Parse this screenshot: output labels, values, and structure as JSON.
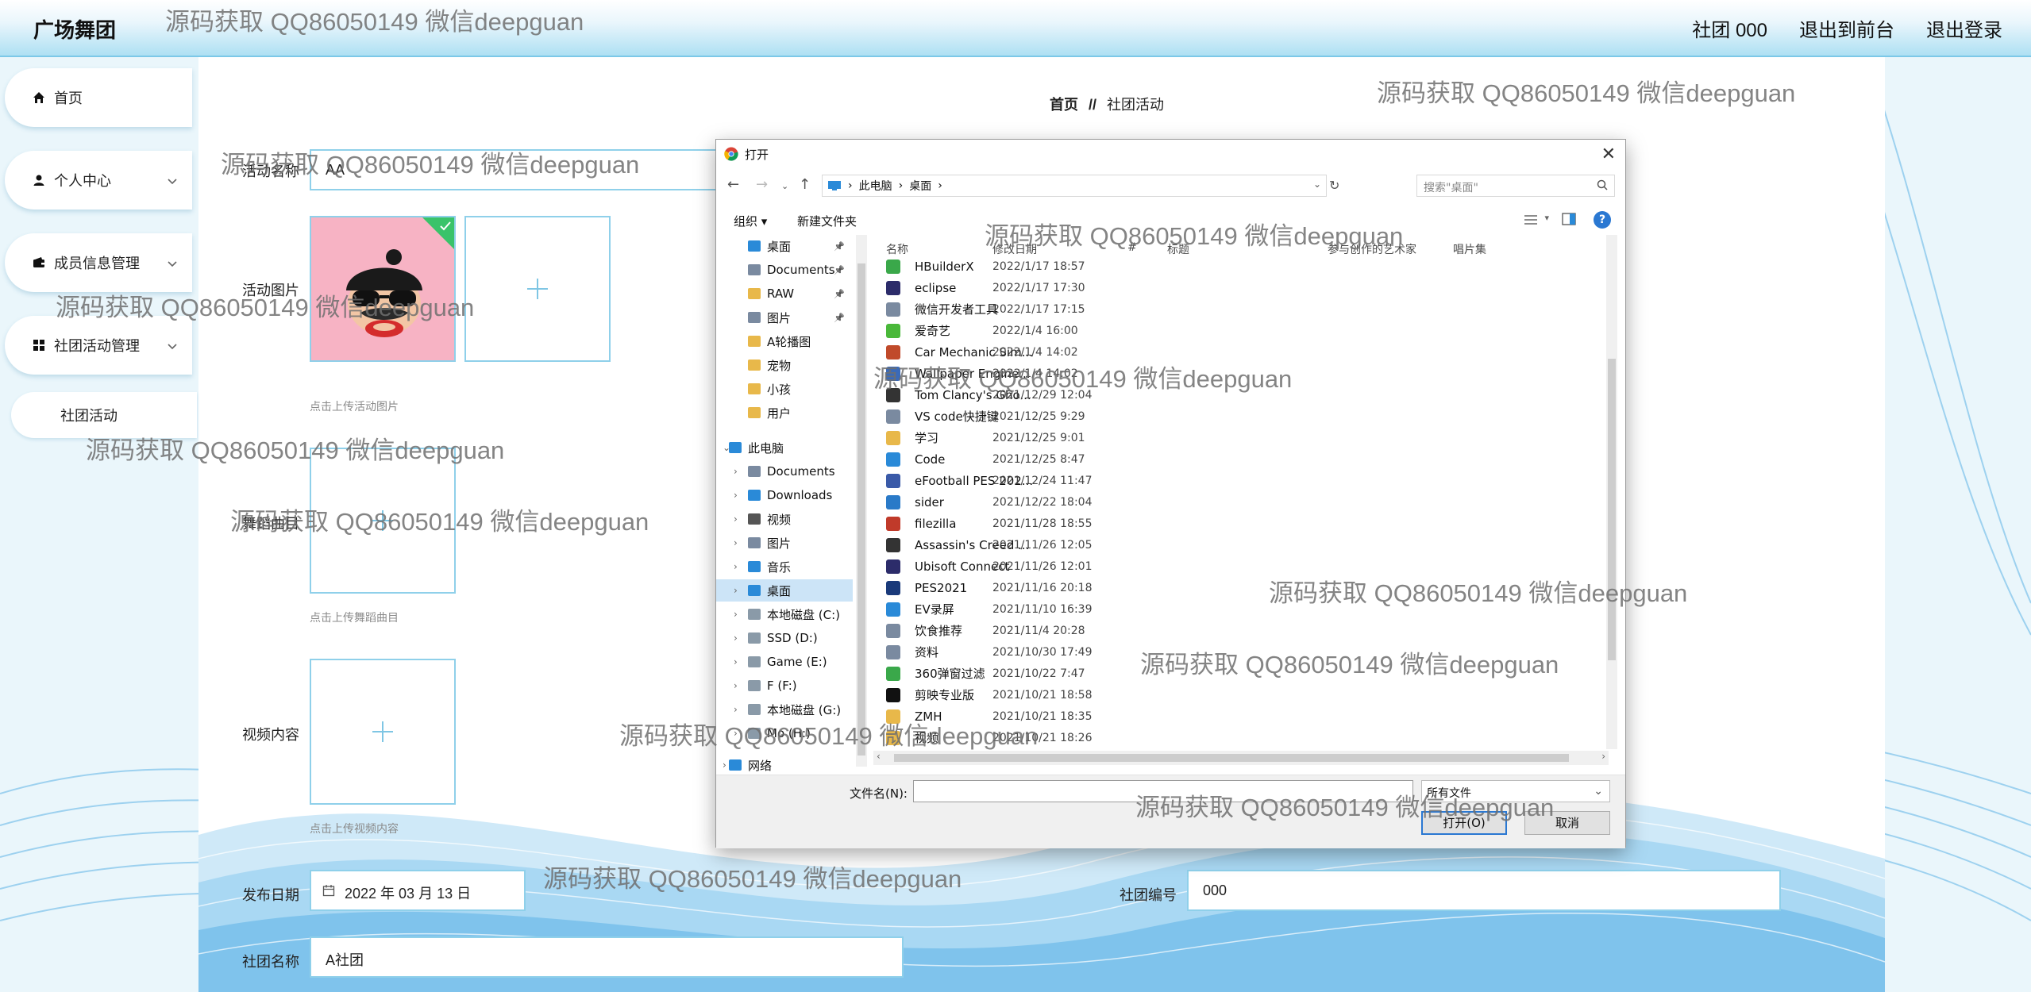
{
  "brand": "广场舞团",
  "topnav": [
    "社团 000",
    "退出到前台",
    "退出登录"
  ],
  "sidebar": {
    "items": [
      {
        "label": "首页"
      },
      {
        "label": "个人中心"
      },
      {
        "label": "成员信息管理"
      },
      {
        "label": "社团活动管理"
      }
    ],
    "sub_item": "社团活动"
  },
  "breadcrumb": {
    "home": "首页",
    "sep": "//",
    "current": "社团活动"
  },
  "form": {
    "activity_name_label": "活动名称",
    "activity_name_value": "AA",
    "activity_image_label": "活动图片",
    "activity_image_hint": "点击上传活动图片",
    "music_label": "舞蹈曲目",
    "music_hint": "点击上传舞蹈曲目",
    "video_label": "视频内容",
    "video_hint": "点击上传视频内容",
    "date_label": "发布日期",
    "date_value": "2022 年 03 月 13 日",
    "club_no_label": "社团编号",
    "club_no_value": "000",
    "club_name_label": "社团名称",
    "club_name_value": "A社团"
  },
  "dialog": {
    "title": "打开",
    "path": [
      "此电脑",
      "桌面"
    ],
    "search_placeholder": "搜索\"桌面\"",
    "organize": "组织 ▾",
    "new_folder": "新建文件夹",
    "tree": [
      {
        "label": "桌面",
        "pinned": true,
        "color": "#2a8ad8"
      },
      {
        "label": "Documents",
        "pinned": true,
        "color": "#7a8aa0"
      },
      {
        "label": "RAW",
        "pinned": true,
        "color": "#e8b84a"
      },
      {
        "label": "图片",
        "pinned": true,
        "color": "#7a8aa0"
      },
      {
        "label": "A轮播图",
        "pinned": false,
        "color": "#e8b84a"
      },
      {
        "label": "宠物",
        "pinned": false,
        "color": "#e8b84a"
      },
      {
        "label": "小孩",
        "pinned": false,
        "color": "#e8b84a"
      },
      {
        "label": "用户",
        "pinned": false,
        "color": "#e8b84a"
      },
      {
        "label": "此电脑",
        "pinned": false,
        "color": "#2a8ad8"
      },
      {
        "label": "Documents",
        "pinned": false,
        "color": "#7a8aa0"
      },
      {
        "label": "Downloads",
        "pinned": false,
        "color": "#2a8ad8"
      },
      {
        "label": "视频",
        "pinned": false,
        "color": "#555555"
      },
      {
        "label": "图片",
        "pinned": false,
        "color": "#7a8aa0"
      },
      {
        "label": "音乐",
        "pinned": false,
        "color": "#2a8ad8"
      },
      {
        "label": "桌面",
        "pinned": false,
        "color": "#2a8ad8"
      },
      {
        "label": "本地磁盘 (C:)",
        "pinned": false,
        "color": "#8a9aa8"
      },
      {
        "label": "SSD (D:)",
        "pinned": false,
        "color": "#8a9aa8"
      },
      {
        "label": "Game (E:)",
        "pinned": false,
        "color": "#8a9aa8"
      },
      {
        "label": "F (F:)",
        "pinned": false,
        "color": "#8a9aa8"
      },
      {
        "label": "本地磁盘 (G:)",
        "pinned": false,
        "color": "#8a9aa8"
      },
      {
        "label": "Mo (H:)",
        "pinned": false,
        "color": "#8a9aa8"
      },
      {
        "label": "网络",
        "pinned": false,
        "color": "#2a8ad8"
      }
    ],
    "columns": [
      "名称",
      "修改日期",
      "#",
      "标题",
      "参与创作的艺术家",
      "唱片集"
    ],
    "files": [
      {
        "name": "HBuilderX",
        "date": "2022/1/17 18:57",
        "color": "#3aa84a"
      },
      {
        "name": "eclipse",
        "date": "2022/1/17 17:30",
        "color": "#2c2c6a"
      },
      {
        "name": "微信开发者工具",
        "date": "2022/1/17 17:15",
        "color": "#7a8aa0"
      },
      {
        "name": "爱奇艺",
        "date": "2022/1/4 16:00",
        "color": "#4ab83a"
      },
      {
        "name": "Car Mechanic Sim...",
        "date": "2022/1/4 14:02",
        "color": "#c04a2a"
      },
      {
        "name": "Wallpaper Engine...",
        "date": "2022/1/4 14:02",
        "color": "#3a6ab8"
      },
      {
        "name": "Tom Clancy's Gho...",
        "date": "2021/12/29 12:04",
        "color": "#333333"
      },
      {
        "name": "VS code快捷键",
        "date": "2021/12/25 9:29",
        "color": "#7a8aa0"
      },
      {
        "name": "学习",
        "date": "2021/12/25 9:01",
        "color": "#e8b84a"
      },
      {
        "name": "Code",
        "date": "2021/12/25 8:47",
        "color": "#2a8ad8"
      },
      {
        "name": "eFootball PES 202...",
        "date": "2021/12/24 11:47",
        "color": "#3a5aa8"
      },
      {
        "name": "sider",
        "date": "2021/12/22 18:04",
        "color": "#2a7ac8"
      },
      {
        "name": "filezilla",
        "date": "2021/11/28 18:55",
        "color": "#c03a2a"
      },
      {
        "name": "Assassin's Creed ...",
        "date": "2021/11/26 12:05",
        "color": "#333333"
      },
      {
        "name": "Ubisoft Connect",
        "date": "2021/11/26 12:01",
        "color": "#2c2c6a"
      },
      {
        "name": "PES2021",
        "date": "2021/11/16 20:18",
        "color": "#1a3a7a"
      },
      {
        "name": "EV录屏",
        "date": "2021/11/10 16:39",
        "color": "#2a8ad8"
      },
      {
        "name": "饮食推荐",
        "date": "2021/11/4 20:28",
        "color": "#7a8aa0"
      },
      {
        "name": "资料",
        "date": "2021/10/30 17:49",
        "color": "#7a8aa0"
      },
      {
        "name": "360弹窗过滤",
        "date": "2021/10/22 7:47",
        "color": "#3aa84a"
      },
      {
        "name": "剪映专业版",
        "date": "2021/10/21 18:58",
        "color": "#111111"
      },
      {
        "name": "ZMH",
        "date": "2021/10/21 18:35",
        "color": "#e8b84a"
      },
      {
        "name": "视频",
        "date": "2021/10/21 18:26",
        "color": "#e8b84a"
      }
    ],
    "filename_label": "文件名(N):",
    "filename_value": "",
    "filetype": "所有文件",
    "open_button": "打开(O)",
    "cancel_button": "取消"
  },
  "watermark": "源码获取 QQ86050149 微信deepguan",
  "colors": {
    "accent": "#8fd0ea",
    "topbar": "#aee0f3",
    "dialog_select": "#cce4f7",
    "primary_button_border": "#2a78d2"
  }
}
